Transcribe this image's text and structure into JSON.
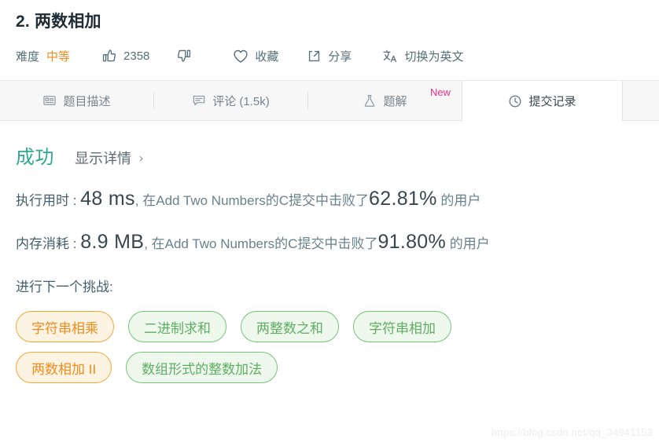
{
  "header": {
    "title": "2. 两数相加",
    "difficulty_label": "难度",
    "difficulty_value": "中等",
    "difficulty_color": "#ef8c1f",
    "likes_icon": "thumbs-up-icon",
    "likes_count": "2358",
    "dislikes_icon": "thumbs-down-icon",
    "favorite_icon": "heart-icon",
    "favorite_label": "收藏",
    "share_icon": "share-icon",
    "share_label": "分享",
    "translate_icon": "translate-icon",
    "translate_label": "切换为英文"
  },
  "tabs": [
    {
      "id": "description",
      "label": "题目描述",
      "icon": "description-icon",
      "active": false,
      "badge": ""
    },
    {
      "id": "comments",
      "label": "评论 (1.5k)",
      "icon": "comment-icon",
      "active": false,
      "badge": ""
    },
    {
      "id": "solutions",
      "label": "题解",
      "icon": "flask-icon",
      "active": false,
      "badge": "New"
    },
    {
      "id": "submissions",
      "label": "提交记录",
      "icon": "clock-icon",
      "active": true,
      "badge": ""
    }
  ],
  "result": {
    "status": "成功",
    "status_color": "#2eab8d",
    "detail_link": "显示详情",
    "detail_chevron": "›",
    "runtime": {
      "label": "执行用时 :",
      "value": "48 ms",
      "middle": ", 在Add Two Numbers的C提交中击败了",
      "percent": "62.81%",
      "tail": " 的用户"
    },
    "memory": {
      "label": "内存消耗 :",
      "value": "8.9 MB",
      "middle": ", 在Add Two Numbers的C提交中击败了",
      "percent": "91.80%",
      "tail": " 的用户"
    },
    "next_challenge_label": "进行下一个挑战:",
    "challenge_rows": [
      [
        {
          "label": "字符串相乘",
          "style": "orange"
        },
        {
          "label": "二进制求和",
          "style": "green"
        },
        {
          "label": "两整数之和",
          "style": "green"
        },
        {
          "label": "字符串相加",
          "style": "green"
        }
      ],
      [
        {
          "label": "两数相加 II",
          "style": "orange"
        },
        {
          "label": "数组形式的整数加法",
          "style": "green"
        }
      ]
    ]
  },
  "watermark": "https://blog.csdn.net/qq_34941153"
}
